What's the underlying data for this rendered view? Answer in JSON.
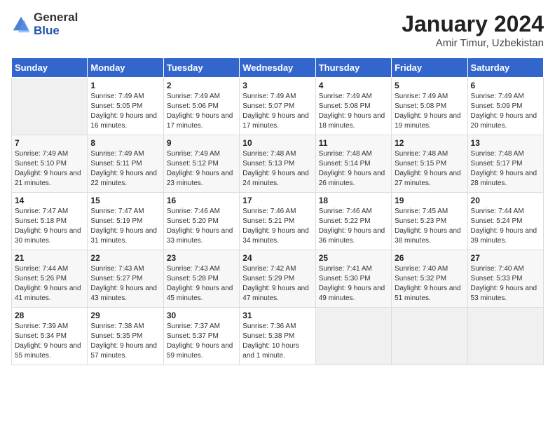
{
  "logo": {
    "general": "General",
    "blue": "Blue"
  },
  "title": "January 2024",
  "subtitle": "Amir Timur, Uzbekistan",
  "days_of_week": [
    "Sunday",
    "Monday",
    "Tuesday",
    "Wednesday",
    "Thursday",
    "Friday",
    "Saturday"
  ],
  "weeks": [
    [
      {
        "num": "",
        "sunrise": "",
        "sunset": "",
        "daylight": ""
      },
      {
        "num": "1",
        "sunrise": "Sunrise: 7:49 AM",
        "sunset": "Sunset: 5:05 PM",
        "daylight": "Daylight: 9 hours and 16 minutes."
      },
      {
        "num": "2",
        "sunrise": "Sunrise: 7:49 AM",
        "sunset": "Sunset: 5:06 PM",
        "daylight": "Daylight: 9 hours and 17 minutes."
      },
      {
        "num": "3",
        "sunrise": "Sunrise: 7:49 AM",
        "sunset": "Sunset: 5:07 PM",
        "daylight": "Daylight: 9 hours and 17 minutes."
      },
      {
        "num": "4",
        "sunrise": "Sunrise: 7:49 AM",
        "sunset": "Sunset: 5:08 PM",
        "daylight": "Daylight: 9 hours and 18 minutes."
      },
      {
        "num": "5",
        "sunrise": "Sunrise: 7:49 AM",
        "sunset": "Sunset: 5:08 PM",
        "daylight": "Daylight: 9 hours and 19 minutes."
      },
      {
        "num": "6",
        "sunrise": "Sunrise: 7:49 AM",
        "sunset": "Sunset: 5:09 PM",
        "daylight": "Daylight: 9 hours and 20 minutes."
      }
    ],
    [
      {
        "num": "7",
        "sunrise": "Sunrise: 7:49 AM",
        "sunset": "Sunset: 5:10 PM",
        "daylight": "Daylight: 9 hours and 21 minutes."
      },
      {
        "num": "8",
        "sunrise": "Sunrise: 7:49 AM",
        "sunset": "Sunset: 5:11 PM",
        "daylight": "Daylight: 9 hours and 22 minutes."
      },
      {
        "num": "9",
        "sunrise": "Sunrise: 7:49 AM",
        "sunset": "Sunset: 5:12 PM",
        "daylight": "Daylight: 9 hours and 23 minutes."
      },
      {
        "num": "10",
        "sunrise": "Sunrise: 7:48 AM",
        "sunset": "Sunset: 5:13 PM",
        "daylight": "Daylight: 9 hours and 24 minutes."
      },
      {
        "num": "11",
        "sunrise": "Sunrise: 7:48 AM",
        "sunset": "Sunset: 5:14 PM",
        "daylight": "Daylight: 9 hours and 26 minutes."
      },
      {
        "num": "12",
        "sunrise": "Sunrise: 7:48 AM",
        "sunset": "Sunset: 5:15 PM",
        "daylight": "Daylight: 9 hours and 27 minutes."
      },
      {
        "num": "13",
        "sunrise": "Sunrise: 7:48 AM",
        "sunset": "Sunset: 5:17 PM",
        "daylight": "Daylight: 9 hours and 28 minutes."
      }
    ],
    [
      {
        "num": "14",
        "sunrise": "Sunrise: 7:47 AM",
        "sunset": "Sunset: 5:18 PM",
        "daylight": "Daylight: 9 hours and 30 minutes."
      },
      {
        "num": "15",
        "sunrise": "Sunrise: 7:47 AM",
        "sunset": "Sunset: 5:19 PM",
        "daylight": "Daylight: 9 hours and 31 minutes."
      },
      {
        "num": "16",
        "sunrise": "Sunrise: 7:46 AM",
        "sunset": "Sunset: 5:20 PM",
        "daylight": "Daylight: 9 hours and 33 minutes."
      },
      {
        "num": "17",
        "sunrise": "Sunrise: 7:46 AM",
        "sunset": "Sunset: 5:21 PM",
        "daylight": "Daylight: 9 hours and 34 minutes."
      },
      {
        "num": "18",
        "sunrise": "Sunrise: 7:46 AM",
        "sunset": "Sunset: 5:22 PM",
        "daylight": "Daylight: 9 hours and 36 minutes."
      },
      {
        "num": "19",
        "sunrise": "Sunrise: 7:45 AM",
        "sunset": "Sunset: 5:23 PM",
        "daylight": "Daylight: 9 hours and 38 minutes."
      },
      {
        "num": "20",
        "sunrise": "Sunrise: 7:44 AM",
        "sunset": "Sunset: 5:24 PM",
        "daylight": "Daylight: 9 hours and 39 minutes."
      }
    ],
    [
      {
        "num": "21",
        "sunrise": "Sunrise: 7:44 AM",
        "sunset": "Sunset: 5:26 PM",
        "daylight": "Daylight: 9 hours and 41 minutes."
      },
      {
        "num": "22",
        "sunrise": "Sunrise: 7:43 AM",
        "sunset": "Sunset: 5:27 PM",
        "daylight": "Daylight: 9 hours and 43 minutes."
      },
      {
        "num": "23",
        "sunrise": "Sunrise: 7:43 AM",
        "sunset": "Sunset: 5:28 PM",
        "daylight": "Daylight: 9 hours and 45 minutes."
      },
      {
        "num": "24",
        "sunrise": "Sunrise: 7:42 AM",
        "sunset": "Sunset: 5:29 PM",
        "daylight": "Daylight: 9 hours and 47 minutes."
      },
      {
        "num": "25",
        "sunrise": "Sunrise: 7:41 AM",
        "sunset": "Sunset: 5:30 PM",
        "daylight": "Daylight: 9 hours and 49 minutes."
      },
      {
        "num": "26",
        "sunrise": "Sunrise: 7:40 AM",
        "sunset": "Sunset: 5:32 PM",
        "daylight": "Daylight: 9 hours and 51 minutes."
      },
      {
        "num": "27",
        "sunrise": "Sunrise: 7:40 AM",
        "sunset": "Sunset: 5:33 PM",
        "daylight": "Daylight: 9 hours and 53 minutes."
      }
    ],
    [
      {
        "num": "28",
        "sunrise": "Sunrise: 7:39 AM",
        "sunset": "Sunset: 5:34 PM",
        "daylight": "Daylight: 9 hours and 55 minutes."
      },
      {
        "num": "29",
        "sunrise": "Sunrise: 7:38 AM",
        "sunset": "Sunset: 5:35 PM",
        "daylight": "Daylight: 9 hours and 57 minutes."
      },
      {
        "num": "30",
        "sunrise": "Sunrise: 7:37 AM",
        "sunset": "Sunset: 5:37 PM",
        "daylight": "Daylight: 9 hours and 59 minutes."
      },
      {
        "num": "31",
        "sunrise": "Sunrise: 7:36 AM",
        "sunset": "Sunset: 5:38 PM",
        "daylight": "Daylight: 10 hours and 1 minute."
      },
      {
        "num": "",
        "sunrise": "",
        "sunset": "",
        "daylight": ""
      },
      {
        "num": "",
        "sunrise": "",
        "sunset": "",
        "daylight": ""
      },
      {
        "num": "",
        "sunrise": "",
        "sunset": "",
        "daylight": ""
      }
    ]
  ]
}
